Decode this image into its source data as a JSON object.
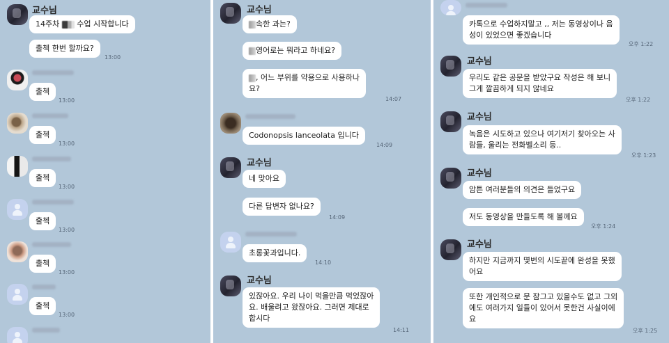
{
  "panel1": {
    "prof_name": "교수님",
    "msgs": {
      "m1": "14주차",
      "m1b": "수업 시작합니다",
      "m2": "출첵 한번 할까요?",
      "chul": "출첵"
    },
    "times": {
      "t1": "13:00",
      "t2": "13:00",
      "t3": "13:00",
      "t4": "13:00",
      "t5": "13:00",
      "t6": "13:00",
      "t7": "13:00"
    }
  },
  "panel2": {
    "prof_name": "교수님",
    "msgs": {
      "m1": "속한 과는?",
      "m2": "영어로는 뭐라고 하네요?",
      "m3": ", 어느 부위를 약용으로 사용하나\n요?",
      "m4": "Codonopsis lanceolata 입니다",
      "m5": "네 맞아요",
      "m6": "다른 답변자 없나요?",
      "m7": "초롱꽃과입니다.",
      "m8": "있잖아요. 우리 나이 먹을만큼 먹었잖아\n요. 배울려고 왔잖아요. 그러면 제대로\n합시다"
    },
    "times": {
      "t1": "14:07",
      "t2": "14:09",
      "t3": "14:09",
      "t4": "14:10",
      "t5": "14:11"
    }
  },
  "panel3": {
    "prof_name": "교수님",
    "msgs": {
      "m1": "카톡으로 수업하지말고 ,, 저는 동영상이나 음\n성이 있었으면 좋겠습니다",
      "m2": "우리도 같은 공문을 받았구요 작성은 해 보니\n그게 깔끔하게 되지 않네요",
      "m3": "녹음은 시도하고 있으나 여기저기 찾아오는 사\n람들, 울리는 전화벨소리 등..",
      "m4": "암튼 여러분들의 의견은 들었구요",
      "m5": "저도 동영상을 만들도록 해 볼께요",
      "m6": "하지만 지금까지 몇번의 시도끝에 완성을 못했\n어요",
      "m7": "또한 개인적으로 문 잠그고 있을수도 없고 그외\n에도 여러가지 일들이 있어서 못한건 사실이에\n요"
    },
    "times": {
      "t1": "오후 1:22",
      "t2": "오후 1:22",
      "t3": "오후 1:23",
      "t4": "오후 1:24",
      "t5": "오후 1:25"
    }
  }
}
